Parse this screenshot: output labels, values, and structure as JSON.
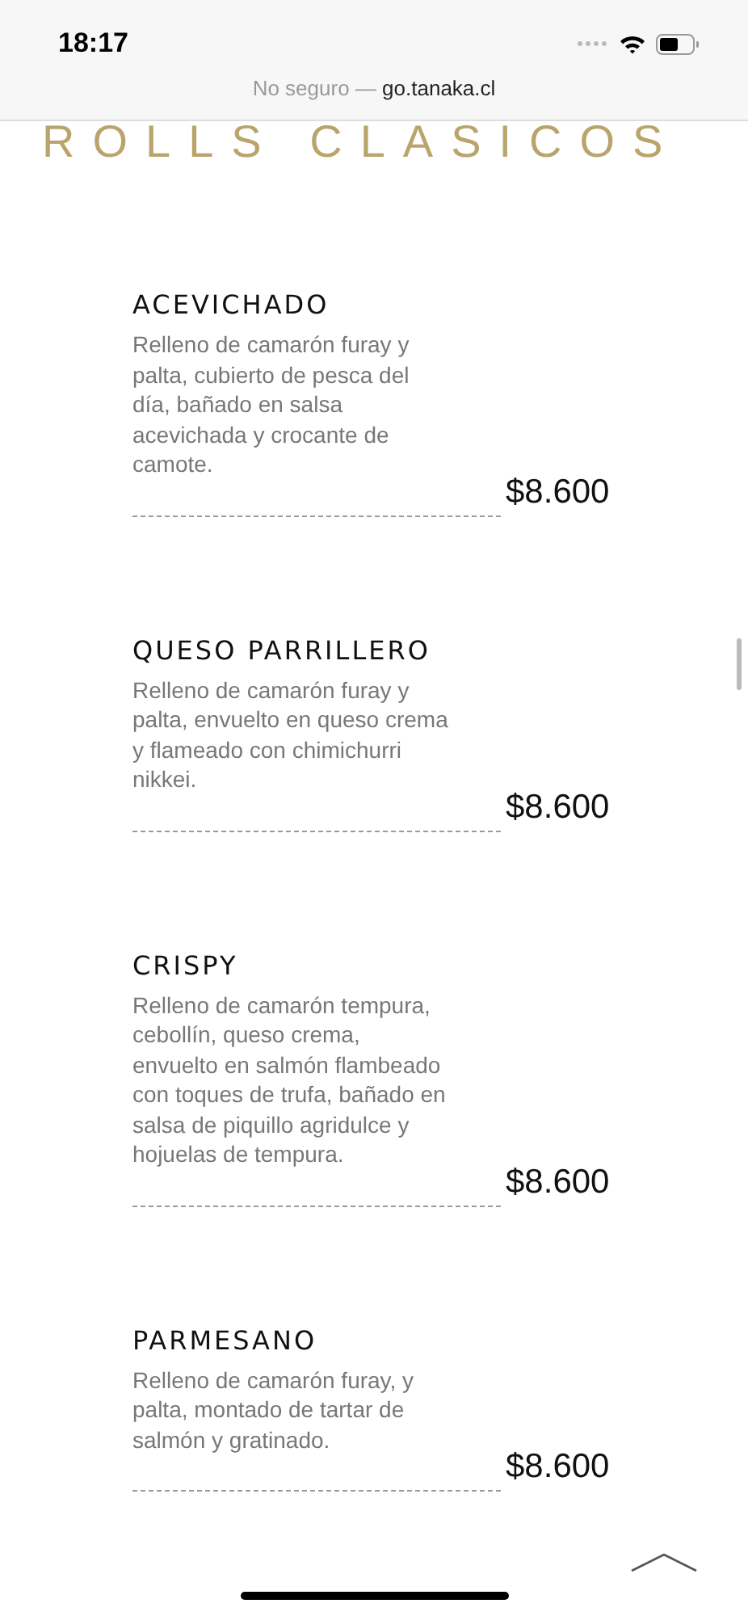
{
  "status_bar": {
    "time": "18:17"
  },
  "address_bar": {
    "security": "No seguro —",
    "domain": "go.tanaka.cl"
  },
  "section_title": "ROLLS CLASICOS",
  "items": [
    {
      "name": "ACEVICHADO",
      "description": "Relleno de camarón furay y palta, cubierto de pesca del día, bañado en salsa acevichada y crocante de camote.",
      "price": "$8.600"
    },
    {
      "name": "QUESO PARRILLERO",
      "description": "Relleno de camarón furay y palta, envuelto en queso crema y flameado con chimichurri nikkei.",
      "price": "$8.600"
    },
    {
      "name": "CRISPY",
      "description": "Relleno de camarón tempura, cebollín, queso crema, envuelto en salmón flambeado con toques de trufa, bañado en salsa de piquillo agridulce y hojuelas de tempura.",
      "price": "$8.600"
    },
    {
      "name": "PARMESANO",
      "description": "Relleno de camarón furay, y palta, montado de tartar de salmón y gratinado.",
      "price": "$8.600"
    }
  ]
}
